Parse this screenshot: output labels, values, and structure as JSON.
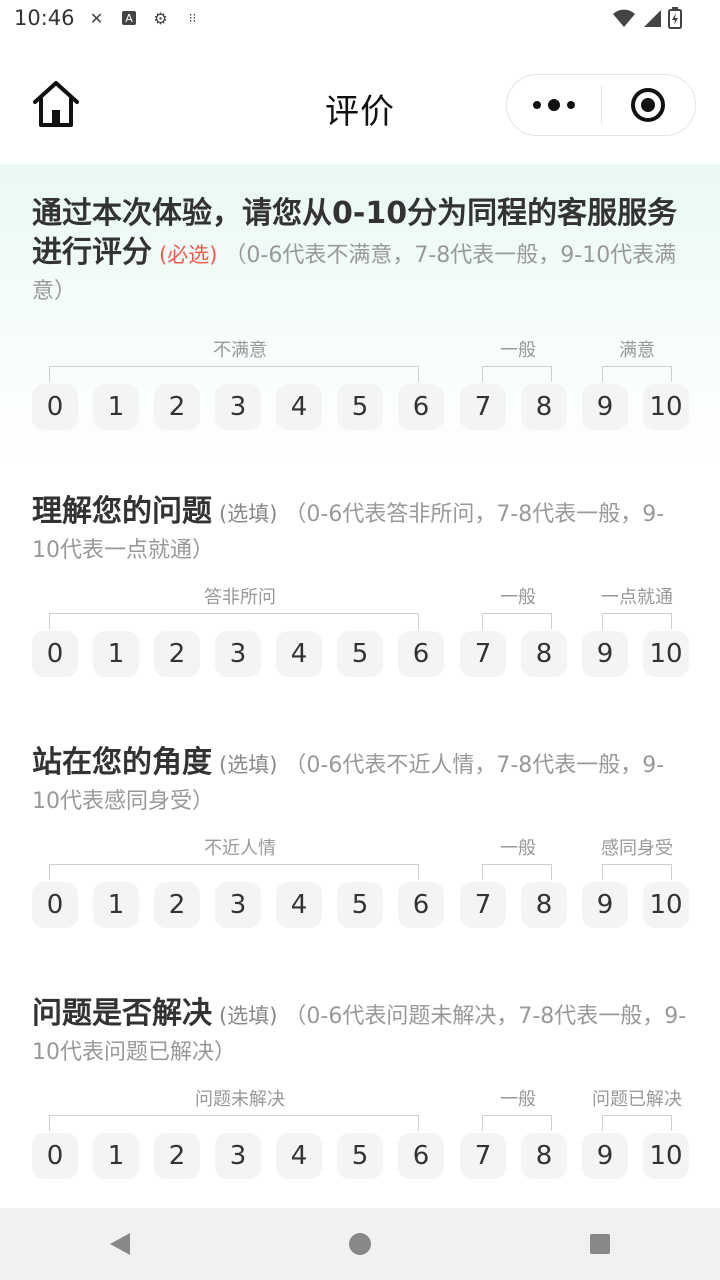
{
  "status_bar": {
    "time": "10:46",
    "icons": [
      "tools-icon",
      "a-badge-icon",
      "settings-gear-icon",
      "dots-icon"
    ],
    "right_icons": [
      "wifi-icon",
      "signal-icon",
      "battery-icon"
    ]
  },
  "navbar": {
    "title": "评价",
    "home_icon": "home-icon",
    "more_icon": "more-dots-icon",
    "close_icon": "target-circle-icon"
  },
  "questions": [
    {
      "title": "通过本次体验，请您从0-10分为同程的客服服务进行评分",
      "tag": "(必选)",
      "tag_type": "required",
      "hint": "（0-6代表不满意，7-8代表一般，9-10代表满意）",
      "label_low": "不满意",
      "label_mid": "一般",
      "label_high": "满意",
      "scale": [
        "0",
        "1",
        "2",
        "3",
        "4",
        "5",
        "6",
        "7",
        "8",
        "9",
        "10"
      ]
    },
    {
      "title": "理解您的问题",
      "tag": "(选填)",
      "tag_type": "optional",
      "hint": "（0-6代表答非所问，7-8代表一般，9-10代表一点就通）",
      "label_low": "答非所问",
      "label_mid": "一般",
      "label_high": "一点就通",
      "scale": [
        "0",
        "1",
        "2",
        "3",
        "4",
        "5",
        "6",
        "7",
        "8",
        "9",
        "10"
      ]
    },
    {
      "title": "站在您的角度",
      "tag": "(选填)",
      "tag_type": "optional",
      "hint": "（0-6代表不近人情，7-8代表一般，9-10代表感同身受）",
      "label_low": "不近人情",
      "label_mid": "一般",
      "label_high": "感同身受",
      "scale": [
        "0",
        "1",
        "2",
        "3",
        "4",
        "5",
        "6",
        "7",
        "8",
        "9",
        "10"
      ]
    },
    {
      "title": "问题是否解决",
      "tag": "(选填)",
      "tag_type": "optional",
      "hint": "（0-6代表问题未解决，7-8代表一般，9-10代表问题已解决）",
      "label_low": "问题未解决",
      "label_mid": "一般",
      "label_high": "问题已解决",
      "scale": [
        "0",
        "1",
        "2",
        "3",
        "4",
        "5",
        "6",
        "7",
        "8",
        "9",
        "10"
      ]
    }
  ],
  "colors": {
    "required": "#ef5b4f",
    "accent_bg": "#eaf9f2",
    "chip_bg": "#f4f4f4"
  },
  "system_nav": {
    "back_icon": "back-triangle-icon",
    "home_icon": "home-circle-icon",
    "recents_icon": "recents-square-icon"
  }
}
